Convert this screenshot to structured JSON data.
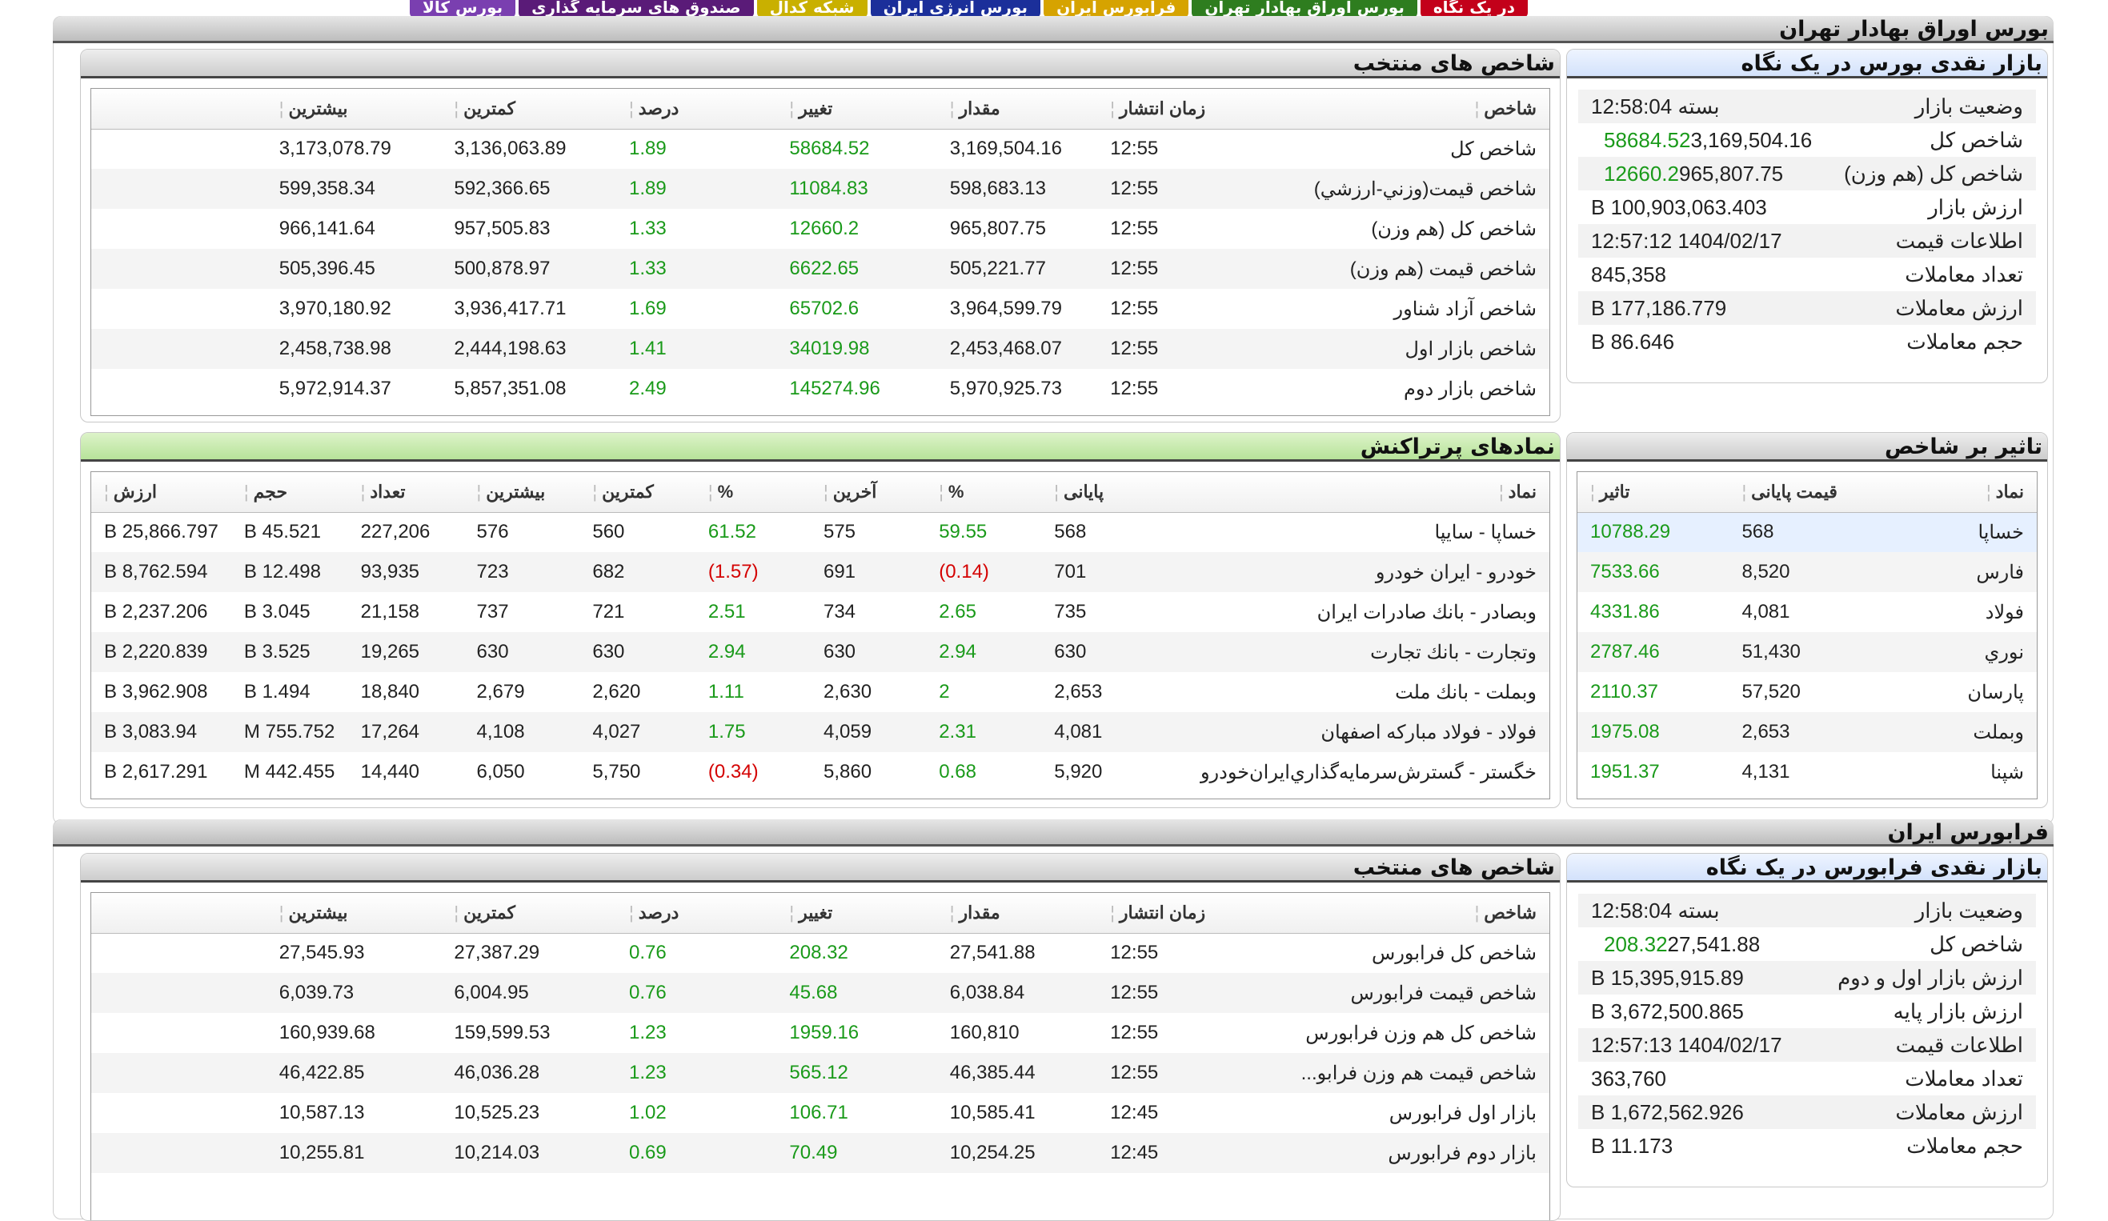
{
  "tabs": [
    {
      "label": "در یک نگاه",
      "color": "#c3001a"
    },
    {
      "label": "بورس اوراق بهادار تهران",
      "color": "#2e7d1f"
    },
    {
      "label": "فرابورس ایران",
      "color": "#d6a300"
    },
    {
      "label": "بورس انرژی ایران",
      "color": "#1b2f9a"
    },
    {
      "label": "شبکه کدال",
      "color": "#c9b000"
    },
    {
      "label": "صندوق های سرمایه گذاری",
      "color": "#5a1b78"
    },
    {
      "label": "بورس کالا",
      "color": "#7a3fb0"
    }
  ],
  "tse": {
    "section_title": "بورس اوراق بهادار تهران",
    "indices": {
      "title": "شاخص های منتخب",
      "headers": [
        "شاخص",
        "زمان انتشار",
        "مقدار",
        "تغییر",
        "درصد",
        "کمترین",
        "بیشترین"
      ],
      "rows": [
        [
          "شاخص كل",
          "12:55",
          "3,169,504.16",
          "58684.52",
          "1.89",
          "3,136,063.89",
          "3,173,078.79"
        ],
        [
          "شاخص قيمت(وزني-ارزشي)",
          "12:55",
          "598,683.13",
          "11084.83",
          "1.89",
          "592,366.65",
          "599,358.34"
        ],
        [
          "شاخص كل (هم وزن)",
          "12:55",
          "965,807.75",
          "12660.2",
          "1.33",
          "957,505.83",
          "966,141.64"
        ],
        [
          "شاخص قيمت (هم وزن)",
          "12:55",
          "505,221.77",
          "6622.65",
          "1.33",
          "500,878.97",
          "505,396.45"
        ],
        [
          "شاخص آزاد شناور",
          "12:55",
          "3,964,599.79",
          "65702.6",
          "1.69",
          "3,936,417.71",
          "3,970,180.92"
        ],
        [
          "شاخص بازار اول",
          "12:55",
          "2,453,468.07",
          "34019.98",
          "1.41",
          "2,444,198.63",
          "2,458,738.98"
        ],
        [
          "شاخص بازار دوم",
          "12:55",
          "5,970,925.73",
          "145274.96",
          "2.49",
          "5,857,351.08",
          "5,972,914.37"
        ]
      ]
    },
    "glance": {
      "title": "بازار نقدی بورس در یک نگاه",
      "rows": [
        {
          "k": "وضعيت بازار",
          "v": "بسته 12:58:04",
          "c": ""
        },
        {
          "k": "شاخص كل",
          "v": "3,169,504.16",
          "c": "58684.52"
        },
        {
          "k": "شاخص كل (هم وزن)",
          "v": "965,807.75",
          "c": "12660.2"
        },
        {
          "k": "ارزش بازار",
          "v": "100,903,063.403 B",
          "c": ""
        },
        {
          "k": "اطلاعات قيمت",
          "v": "1404/02/17 12:57:12",
          "c": ""
        },
        {
          "k": "تعداد معاملات",
          "v": "845,358",
          "c": ""
        },
        {
          "k": "ارزش معاملات",
          "v": "177,186.779 B",
          "c": ""
        },
        {
          "k": "حجم معاملات",
          "v": "86.646 B",
          "c": ""
        }
      ]
    },
    "active": {
      "title": "نمادهای پرتراکنش",
      "headers": [
        "نماد",
        "پایانی",
        "%",
        "آخرین",
        "%",
        "کمترین",
        "بیشترین",
        "تعداد",
        "حجم",
        "ارزش"
      ],
      "rows": [
        [
          "خساپا - سايپا",
          "568",
          "59.55",
          "575",
          "61.52",
          "560",
          "576",
          "227,206",
          "45.521 B",
          "25,866.797 B"
        ],
        [
          "خودرو - ايران خودرو",
          "701",
          "(0.14)",
          "691",
          "(1.57)",
          "682",
          "723",
          "93,935",
          "12.498 B",
          "8,762.594 B"
        ],
        [
          "وبصادر - بانك صادرات ايران",
          "735",
          "2.65",
          "734",
          "2.51",
          "721",
          "737",
          "21,158",
          "3.045 B",
          "2,237.206 B"
        ],
        [
          "وتجارت - بانك تجارت",
          "630",
          "2.94",
          "630",
          "2.94",
          "630",
          "630",
          "19,265",
          "3.525 B",
          "2,220.839 B"
        ],
        [
          "وبملت - بانك ملت",
          "2,653",
          "2",
          "2,630",
          "1.11",
          "2,620",
          "2,679",
          "18,840",
          "1.494 B",
          "3,962.908 B"
        ],
        [
          "فولاد - فولاد مباركه اصفهان",
          "4,081",
          "2.31",
          "4,059",
          "1.75",
          "4,027",
          "4,108",
          "17,264",
          "755.752 M",
          "3,083.94 B"
        ],
        [
          "خگستر - گسترش‌سرمايه‌گذاري‌ايران‌خودرو",
          "5,920",
          "0.68",
          "5,860",
          "(0.34)",
          "5,750",
          "6,050",
          "14,440",
          "442.455 M",
          "2,617.291 B"
        ]
      ]
    },
    "impact": {
      "title": "تاثیر بر شاخص",
      "headers": [
        "نماد",
        "قیمت پایانی",
        "تاثیر"
      ],
      "rows": [
        [
          "خساپا",
          "568",
          "10788.29"
        ],
        [
          "فارس",
          "8,520",
          "7533.66"
        ],
        [
          "فولاد",
          "4,081",
          "4331.86"
        ],
        [
          "نوري",
          "51,430",
          "2787.46"
        ],
        [
          "پارسان",
          "57,520",
          "2110.37"
        ],
        [
          "وبملت",
          "2,653",
          "1975.08"
        ],
        [
          "شپنا",
          "4,131",
          "1951.37"
        ]
      ]
    }
  },
  "ifb": {
    "section_title": "فرابورس ایران",
    "indices": {
      "title": "شاخص های منتخب",
      "headers": [
        "شاخص",
        "زمان انتشار",
        "مقدار",
        "تغییر",
        "درصد",
        "کمترین",
        "بیشترین"
      ],
      "rows": [
        [
          "شاخص كل فرابورس",
          "12:55",
          "27,541.88",
          "208.32",
          "0.76",
          "27,387.29",
          "27,545.93"
        ],
        [
          "شاخص قيمت فرابورس",
          "12:55",
          "6,038.84",
          "45.68",
          "0.76",
          "6,004.95",
          "6,039.73"
        ],
        [
          "شاخص كل هم وزن فرابورس",
          "12:55",
          "160,810",
          "1959.16",
          "1.23",
          "159,599.53",
          "160,939.68"
        ],
        [
          "شاخص قيمت هم وزن فرابو...",
          "12:55",
          "46,385.44",
          "565.12",
          "1.23",
          "46,036.28",
          "46,422.85"
        ],
        [
          "بازار اول فرابورس",
          "12:45",
          "10,585.41",
          "106.71",
          "1.02",
          "10,525.23",
          "10,587.13"
        ],
        [
          "بازار دوم فرابورس",
          "12:45",
          "10,254.25",
          "70.49",
          "0.69",
          "10,214.03",
          "10,255.81"
        ]
      ]
    },
    "glance": {
      "title": "بازار نقدی فرابورس در یک نگاه",
      "rows": [
        {
          "k": "وضعيت بازار",
          "v": "بسته 12:58:04",
          "c": ""
        },
        {
          "k": "شاخص كل",
          "v": "27,541.88",
          "c": "208.32"
        },
        {
          "k": "ارزش بازار اول و دوم",
          "v": "15,395,915.89 B",
          "c": ""
        },
        {
          "k": "ارزش بازار پايه",
          "v": "3,672,500.865 B",
          "c": ""
        },
        {
          "k": "اطلاعات قيمت",
          "v": "1404/02/17 12:57:13",
          "c": ""
        },
        {
          "k": "تعداد معاملات",
          "v": "363,760",
          "c": ""
        },
        {
          "k": "ارزش معاملات",
          "v": "1,672,562.926 B",
          "c": ""
        },
        {
          "k": "حجم معاملات",
          "v": "11.173 B",
          "c": ""
        }
      ]
    }
  }
}
